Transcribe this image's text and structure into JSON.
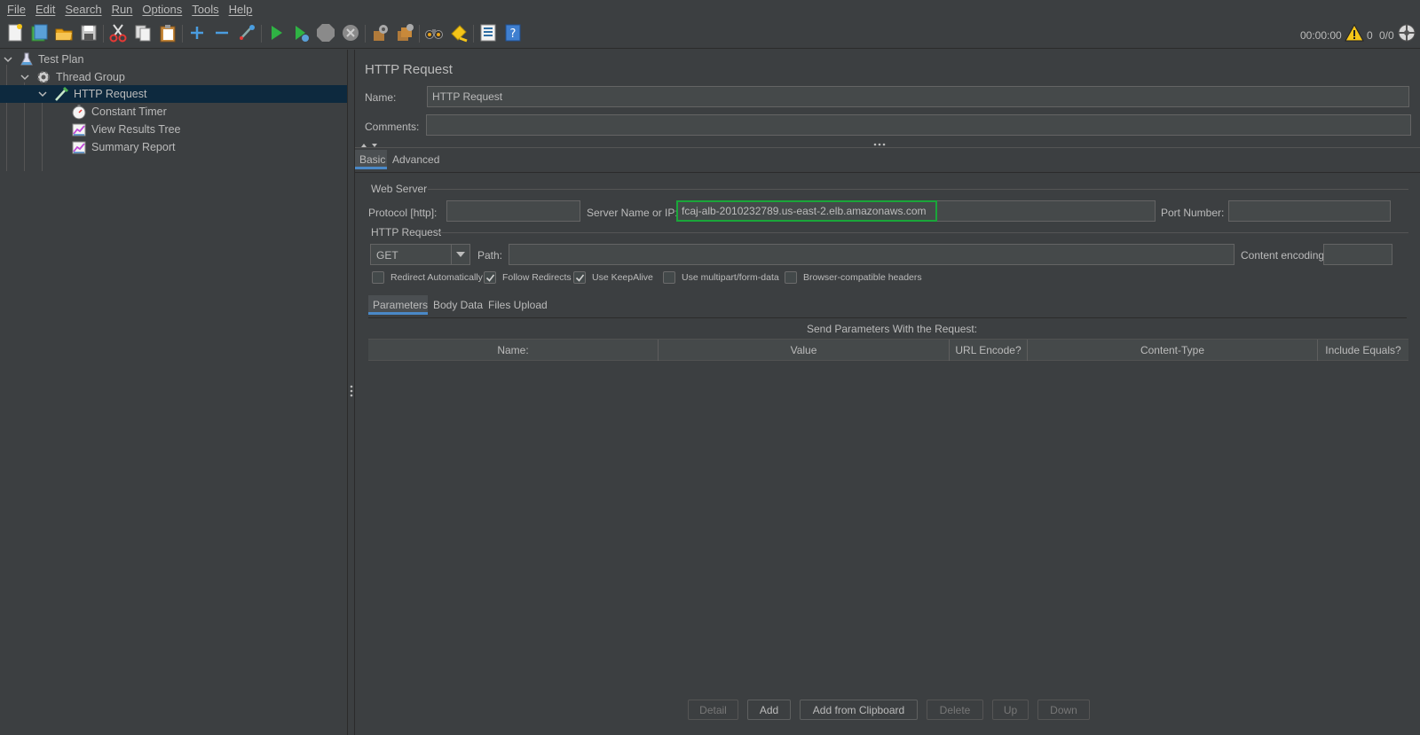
{
  "menu": [
    "File",
    "Edit",
    "Search",
    "Run",
    "Options",
    "Tools",
    "Help"
  ],
  "toolbar": {
    "timer": "00:00:00",
    "warning_count": "0",
    "thread_count": "0/0",
    "icons": [
      "new-icon",
      "templates-icon",
      "open-icon",
      "save-icon",
      "cut-icon",
      "copy-icon",
      "paste-icon",
      "expand-icon",
      "collapse-icon",
      "toggle-icon",
      "start-icon",
      "start-no-pauses-icon",
      "stop-icon",
      "shutdown-icon",
      "clear-icon",
      "clear-all-icon",
      "search-icon",
      "reset-search-icon",
      "function-helper-icon",
      "help-icon"
    ]
  },
  "tree": {
    "items": [
      {
        "label": "Test Plan",
        "icon": "flask-icon"
      },
      {
        "label": "Thread Group",
        "icon": "gear-icon"
      },
      {
        "label": "HTTP Request",
        "icon": "pipette-icon"
      },
      {
        "label": "Constant Timer",
        "icon": "stopwatch-icon"
      },
      {
        "label": "View Results Tree",
        "icon": "graph-icon"
      },
      {
        "label": "Summary Report",
        "icon": "graph-icon"
      }
    ]
  },
  "panel": {
    "title": "HTTP Request",
    "name_label": "Name:",
    "name_value": "HTTP Request",
    "comments_label": "Comments:",
    "comments_value": "",
    "tabs": [
      "Basic",
      "Advanced"
    ],
    "web_server": {
      "legend": "Web Server",
      "protocol_label": "Protocol [http]:",
      "protocol_value": "",
      "server_label": "Server Name or IP:",
      "server_value": "fcaj-alb-2010232789.us-east-2.elb.amazonaws.com",
      "port_label": "Port Number:",
      "port_value": ""
    },
    "http_request": {
      "legend": "HTTP Request",
      "method": "GET",
      "path_label": "Path:",
      "path_value": "",
      "encoding_label": "Content encoding:",
      "encoding_value": ""
    },
    "checkboxes": [
      {
        "label": "Redirect Automatically",
        "checked": false
      },
      {
        "label": "Follow Redirects",
        "checked": true
      },
      {
        "label": "Use KeepAlive",
        "checked": true
      },
      {
        "label": "Use multipart/form-data",
        "checked": false
      },
      {
        "label": "Browser-compatible headers",
        "checked": false
      }
    ],
    "subtabs": [
      "Parameters",
      "Body Data",
      "Files Upload"
    ],
    "params_caption": "Send Parameters With the Request:",
    "columns": [
      "Name:",
      "Value",
      "URL Encode?",
      "Content-Type",
      "Include Equals?"
    ],
    "buttons": [
      "Detail",
      "Add",
      "Add from Clipboard",
      "Delete",
      "Up",
      "Down"
    ]
  },
  "colors": {
    "background": "#3c3f41",
    "selection": "#0d293e",
    "focus_border": "#1aa63a",
    "tab_accent": "#4a88c7"
  }
}
